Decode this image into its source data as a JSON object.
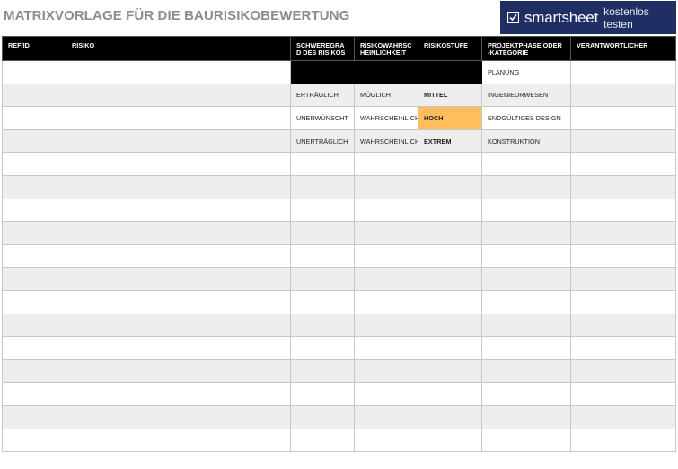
{
  "page": {
    "title": "MATRIXVORLAGE FÜR DIE BAURISIKOBEWERTUNG"
  },
  "banner": {
    "brand": "smartsheet",
    "cta": "kostenlos testen",
    "icon": "smartsheet-check-icon",
    "color": "#1f2f63"
  },
  "table": {
    "headers": [
      "REF/ID",
      "RISIKO",
      "SCHWEREGRAD DES RISIKOS",
      "RISIKOWAHRSCHEINLICHKEIT",
      "RISIKOSTUFE",
      "PROJEKTPHASE ODER -KATEGORIE",
      "VERANTWORTLICHER"
    ],
    "rows": [
      [
        "",
        "",
        "",
        "",
        "",
        "PLANUNG",
        ""
      ],
      [
        "",
        "",
        "ERTRÄGLICH",
        "MÖGLICH",
        "MITTEL",
        "INGENIEURWESEN",
        ""
      ],
      [
        "",
        "",
        "UNERWÜNSCHT",
        "WAHRSCHEINLICH",
        "HOCH",
        "ENDGÜLTIGES DESIGN",
        ""
      ],
      [
        "",
        "",
        "UNERTRÄGLICH",
        "WAHRSCHEINLICH",
        "EXTREM",
        "KONSTRUKTION",
        ""
      ],
      [
        "",
        "",
        "",
        "",
        "",
        "",
        ""
      ],
      [
        "",
        "",
        "",
        "",
        "",
        "",
        ""
      ],
      [
        "",
        "",
        "",
        "",
        "",
        "",
        ""
      ],
      [
        "",
        "",
        "",
        "",
        "",
        "",
        ""
      ],
      [
        "",
        "",
        "",
        "",
        "",
        "",
        ""
      ],
      [
        "",
        "",
        "",
        "",
        "",
        "",
        ""
      ],
      [
        "",
        "",
        "",
        "",
        "",
        "",
        ""
      ],
      [
        "",
        "",
        "",
        "",
        "",
        "",
        ""
      ],
      [
        "",
        "",
        "",
        "",
        "",
        "",
        ""
      ],
      [
        "",
        "",
        "",
        "",
        "",
        "",
        ""
      ],
      [
        "",
        "",
        "",
        "",
        "",
        "",
        ""
      ],
      [
        "",
        "",
        "",
        "",
        "",
        "",
        ""
      ],
      [
        "",
        "",
        "",
        "",
        "",
        "",
        ""
      ]
    ],
    "highlight_color": "#ffbe5c",
    "header_bg": "#000000",
    "alt_row_bg": "#eeeeee"
  }
}
